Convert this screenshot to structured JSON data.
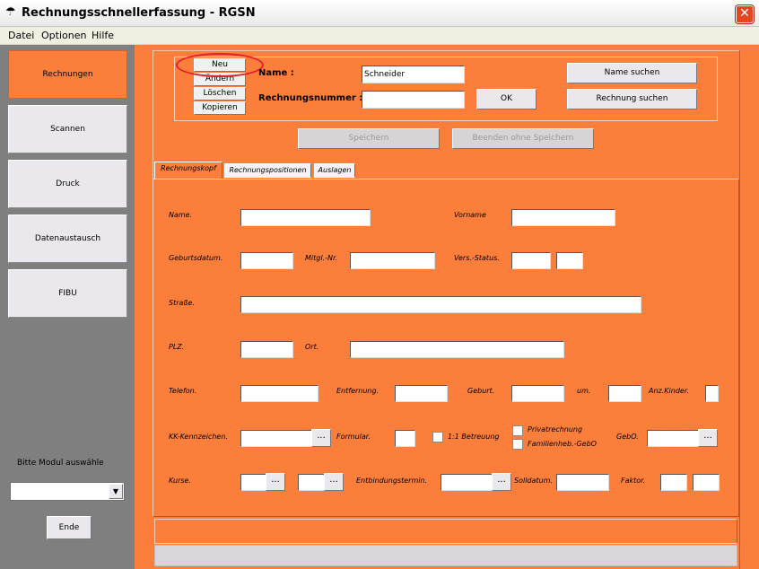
{
  "window": {
    "title": "Rechnungsschnellerfassung - RGSN",
    "close_label": "✕"
  },
  "menu": [
    "Datei",
    "Optionen",
    "Hilfe"
  ],
  "sidebar": {
    "items": [
      "Rechnungen",
      "Scannen",
      "Druck",
      "Datenaustausch",
      "FIBU"
    ],
    "module_label": "Bitte Modul auswähle",
    "module_value": "",
    "end_label": "Ende"
  },
  "record_buttons": [
    "Neu",
    "Ändern",
    "Löschen",
    "Kopieren"
  ],
  "search": {
    "name_label": "Name :",
    "name_value": "Schneider",
    "number_label": "Rechnungsnummer :",
    "number_value": "",
    "ok_label": "OK",
    "find_name_label": "Name suchen",
    "find_invoice_label": "Rechnung suchen"
  },
  "actions": {
    "save_label": "Speichern",
    "exit_label": "Beenden ohne Speichern"
  },
  "tabs": [
    "Rechnungskopf",
    "Rechnungspositionen",
    "Auslagen"
  ],
  "form": {
    "name": "Name.",
    "vorname": "Vorname",
    "geburtsdatum": "Geburtsdatum.",
    "mitgl": "Mitgl.-Nr.",
    "vers_status": "Vers.-Status.",
    "strasse": "Straße.",
    "plz": "PLZ.",
    "ort": "Ort.",
    "telefon": "Telefon.",
    "entfernung": "Entfernung.",
    "geburt": "Geburt.",
    "um": "um.",
    "anz_kinder": "Anz.Kinder.",
    "kk_kennzeichen": "KK-Kennzeichen.",
    "formular": "Formular.",
    "betreuung": "1:1 Betreuung",
    "privatrechnung": "Privatrechnung",
    "familienheb": "Familienheb.-GebO",
    "gebo": "GebO.",
    "kurse": "Kurse.",
    "entbindungstermin": "Entbindungstermin.",
    "solldatum": "Solldatum.",
    "faktor": "Faktor.",
    "ellipsis": "..."
  }
}
